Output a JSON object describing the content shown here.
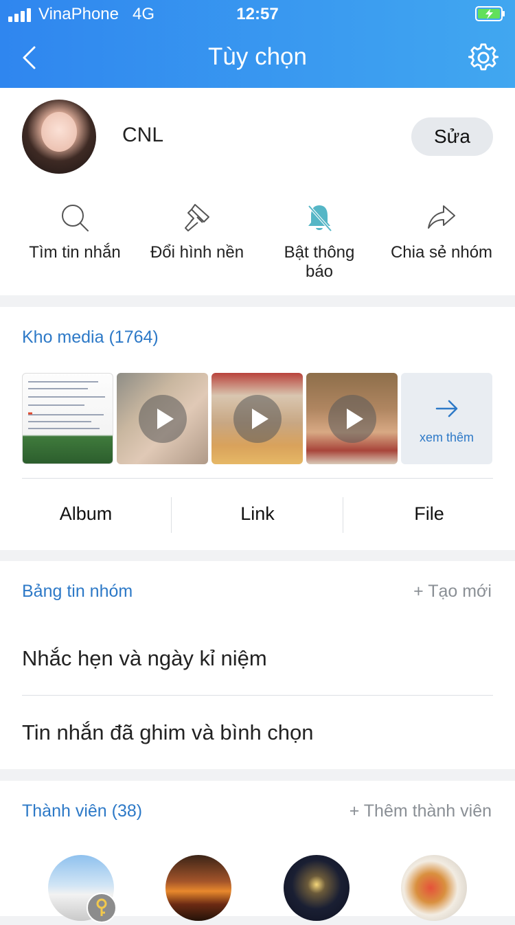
{
  "status": {
    "carrier": "VinaPhone",
    "network": "4G",
    "time": "12:57"
  },
  "nav": {
    "title": "Tùy chọn",
    "back_icon": "chevron-left-icon",
    "settings_icon": "gear-icon"
  },
  "profile": {
    "name": "CNL",
    "edit_label": "Sửa"
  },
  "actions": [
    {
      "label": "Tìm tin nhắn",
      "icon": "search-icon"
    },
    {
      "label": "Đổi hình nền",
      "icon": "paint-brush-icon"
    },
    {
      "label": "Bật thông\nbáo",
      "icon": "bell-muted-icon"
    },
    {
      "label": "Chia sẻ nhóm",
      "icon": "share-icon"
    }
  ],
  "media": {
    "title": "Kho media (1764)",
    "more_label": "xem thêm",
    "tabs": [
      "Album",
      "Link",
      "File"
    ]
  },
  "board": {
    "title": "Bảng tin nhóm",
    "create_label": "+ Tạo mới",
    "items": [
      "Nhắc hẹn và ngày kỉ niệm",
      "Tin nhắn đã ghim và bình chọn"
    ]
  },
  "members": {
    "title": "Thành viên (38)",
    "add_label": "+ Thêm thành viên"
  },
  "colors": {
    "header_start": "#2f86ef",
    "header_end": "#41a7f0",
    "accent": "#2d79c7",
    "muted_bell": "#55b6c6"
  }
}
